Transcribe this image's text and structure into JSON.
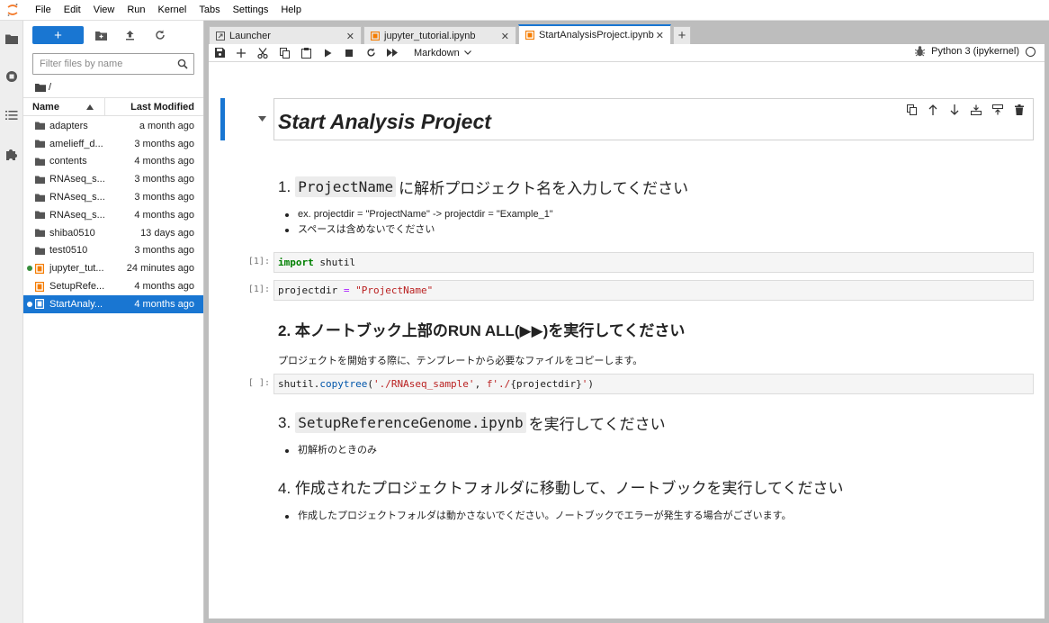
{
  "menu": [
    "File",
    "Edit",
    "View",
    "Run",
    "Kernel",
    "Tabs",
    "Settings",
    "Help"
  ],
  "file_browser": {
    "new_label": "+",
    "filter_placeholder": "Filter files by name",
    "breadcrumb": "/",
    "col_name": "Name",
    "col_modified": "Last Modified",
    "files": [
      {
        "name": "adapters",
        "modified": "a month ago",
        "icon": "folder-icon",
        "running": false,
        "selected": false
      },
      {
        "name": "amelieff_d...",
        "modified": "3 months ago",
        "icon": "folder-icon",
        "running": false,
        "selected": false
      },
      {
        "name": "contents",
        "modified": "4 months ago",
        "icon": "folder-icon",
        "running": false,
        "selected": false
      },
      {
        "name": "RNAseq_s...",
        "modified": "3 months ago",
        "icon": "folder-icon",
        "running": false,
        "selected": false
      },
      {
        "name": "RNAseq_s...",
        "modified": "3 months ago",
        "icon": "folder-icon",
        "running": false,
        "selected": false
      },
      {
        "name": "RNAseq_s...",
        "modified": "4 months ago",
        "icon": "folder-icon",
        "running": false,
        "selected": false
      },
      {
        "name": "shiba0510",
        "modified": "13 days ago",
        "icon": "folder-icon",
        "running": false,
        "selected": false
      },
      {
        "name": "test0510",
        "modified": "3 months ago",
        "icon": "folder-icon",
        "running": false,
        "selected": false
      },
      {
        "name": "jupyter_tut...",
        "modified": "24 minutes ago",
        "icon": "notebook-icon",
        "running": true,
        "selected": false
      },
      {
        "name": "SetupRefe...",
        "modified": "4 months ago",
        "icon": "notebook-icon",
        "running": false,
        "selected": false
      },
      {
        "name": "StartAnaly...",
        "modified": "4 months ago",
        "icon": "notebook-icon",
        "running": true,
        "selected": true
      }
    ]
  },
  "tabs": [
    {
      "label": "Launcher",
      "icon": "launcher-icon",
      "active": false
    },
    {
      "label": "jupyter_tutorial.ipynb",
      "icon": "notebook-icon",
      "active": false
    },
    {
      "label": "StartAnalysisProject.ipynb",
      "icon": "notebook-icon",
      "active": true
    }
  ],
  "toolbar": {
    "cell_type": "Markdown",
    "kernel_name": "Python 3 (ipykernel)"
  },
  "notebook": {
    "title": "Start Analysis Project",
    "s1": {
      "num": "1.",
      "code": "ProjectName",
      "text": "に解析プロジェクト名を入力してください",
      "bullets": [
        "ex. projectdir = \"ProjectName\" -> projectdir = \"Example_1\"",
        "スペースは含めないでください"
      ]
    },
    "c1": {
      "prompt": "[1]:",
      "kw": "import",
      "rest": " shutil"
    },
    "c2": {
      "prompt": "[1]:",
      "var": "projectdir ",
      "op": "=",
      "str": " \"ProjectName\""
    },
    "s2": {
      "text": "2. 本ノートブック上部のRUN ALL(▶▶)を実行してください",
      "para": "プロジェクトを開始する際に、テンプレートから必要なファイルをコピーします。"
    },
    "c3": {
      "prompt": "[ ]:",
      "obj": "shutil.",
      "fn": "copytree",
      "open": "(",
      "s1": "'./RNAseq_sample'",
      "mid": ", ",
      "s2": "f'./",
      "inner": "{projectdir}",
      "s3": "'",
      "close": ")"
    },
    "s3": {
      "num": "3.",
      "code": "SetupReferenceGenome.ipynb",
      "text": "を実行してください",
      "bullets": [
        "初解析のときのみ"
      ]
    },
    "s4": {
      "text": "4. 作成されたプロジェクトフォルダに移動して、ノートブックを実行してください",
      "bullets": [
        "作成したプロジェクトフォルダは動かさないでください。ノートブックでエラーが発生する場合がございます。"
      ]
    }
  },
  "colors": {
    "accent": "#1976d2",
    "notebook_icon": "#f57c00",
    "running_dot": "#388e3c"
  }
}
